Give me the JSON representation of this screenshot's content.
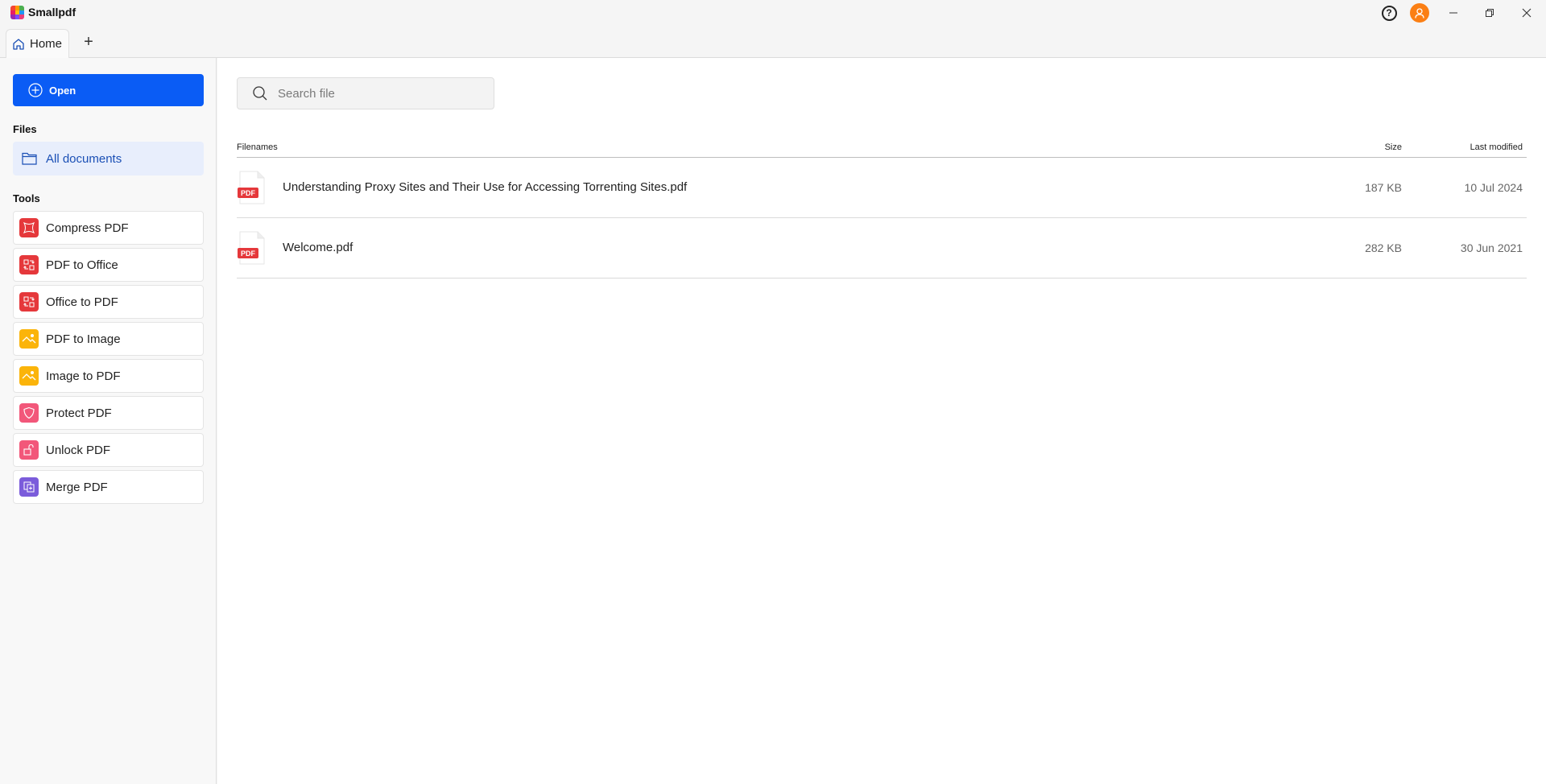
{
  "app": {
    "name": "Smallpdf",
    "logo_colors": [
      "#f44336",
      "#ff9800",
      "#4caf50",
      "#e91e63",
      "#ffc107",
      "#2196f3",
      "#9c27b0",
      "#7c4dff",
      "#ec407a"
    ]
  },
  "titlebar": {
    "help_icon": "question-circle-icon",
    "avatar_icon": "user-icon",
    "avatar_color": "#fb7f14",
    "minimize_icon": "minimize-icon",
    "restore_icon": "restore-icon",
    "close_icon": "close-icon"
  },
  "tabs": [
    {
      "label": "Home",
      "icon": "home-icon",
      "active": true
    }
  ],
  "tab_add_label": "+",
  "sidebar": {
    "open_button": {
      "label": "Open",
      "icon": "plus-circle-icon",
      "color": "#0a5cf5"
    },
    "files_heading": "Files",
    "files_items": [
      {
        "label": "All documents",
        "icon": "folder-icon",
        "active": true
      }
    ],
    "tools_heading": "Tools",
    "tools": [
      {
        "label": "Compress PDF",
        "icon": "compress-icon",
        "color": "#e5383b"
      },
      {
        "label": "PDF to Office",
        "icon": "convert-icon",
        "color": "#e5383b"
      },
      {
        "label": "Office to PDF",
        "icon": "convert-icon",
        "color": "#e5383b"
      },
      {
        "label": "PDF to Image",
        "icon": "image-icon",
        "color": "#fbb40a"
      },
      {
        "label": "Image to PDF",
        "icon": "image-icon",
        "color": "#fbb40a"
      },
      {
        "label": "Protect PDF",
        "icon": "shield-icon",
        "color": "#f2577a"
      },
      {
        "label": "Unlock PDF",
        "icon": "unlock-icon",
        "color": "#f2577a"
      },
      {
        "label": "Merge PDF",
        "icon": "merge-icon",
        "color": "#7b5cdb"
      }
    ]
  },
  "main": {
    "search": {
      "placeholder": "Search file",
      "value": ""
    },
    "columns": {
      "name": "Filenames",
      "size": "Size",
      "modified": "Last modified"
    },
    "files": [
      {
        "name": "Understanding Proxy Sites and Their Use for Accessing Torrenting Sites.pdf",
        "size": "187 KB",
        "modified": "10 Jul 2024",
        "badge": "PDF"
      },
      {
        "name": "Welcome.pdf",
        "size": "282 KB",
        "modified": "30 Jun 2021",
        "badge": "PDF"
      }
    ]
  }
}
